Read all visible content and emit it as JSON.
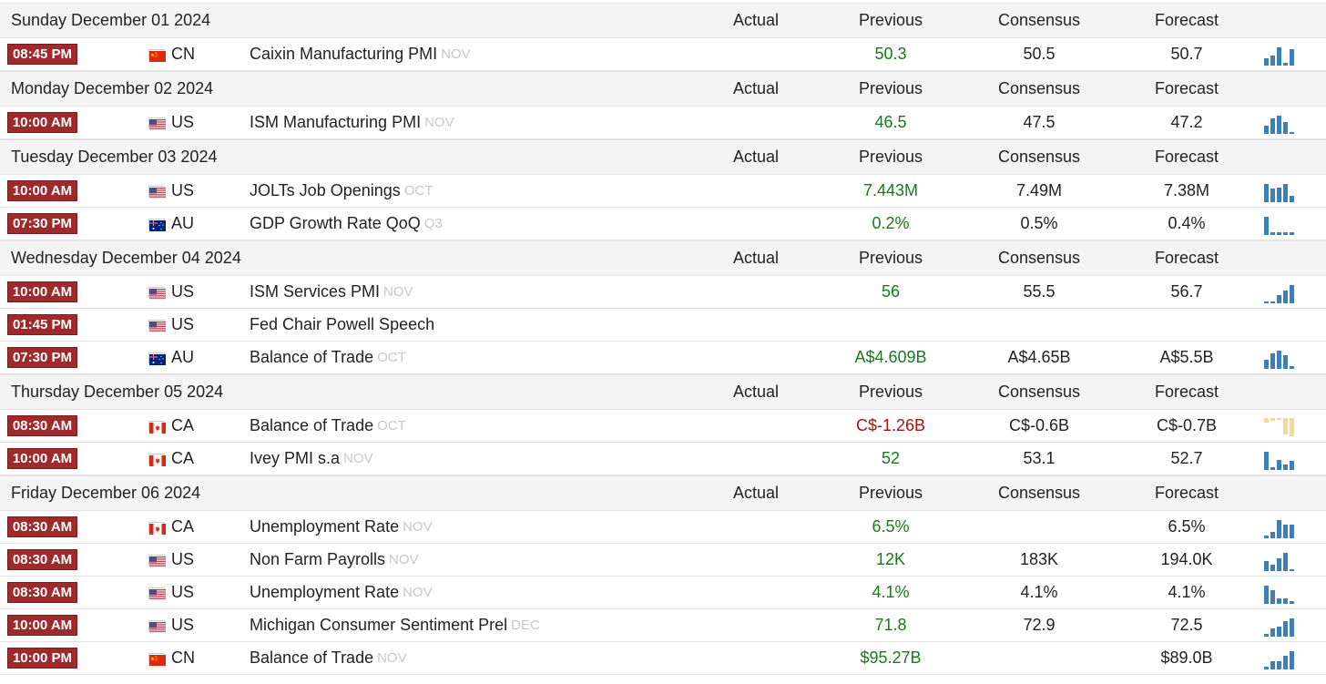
{
  "columns": {
    "actual": "Actual",
    "previous": "Previous",
    "consensus": "Consensus",
    "forecast": "Forecast"
  },
  "days": [
    {
      "date": "Sunday December 01 2024",
      "events": [
        {
          "time": "08:45 PM",
          "flag": "cn",
          "country": "CN",
          "event": "Caixin Manufacturing PMI",
          "ref": "NOV",
          "actual": "",
          "previous": "50.3",
          "previous_trend": "up",
          "consensus": "50.5",
          "forecast": "50.7",
          "spark": [
            0.4,
            0.55,
            1.0,
            0.15,
            0.9
          ],
          "spark_color": "blue"
        }
      ]
    },
    {
      "date": "Monday December 02 2024",
      "events": [
        {
          "time": "10:00 AM",
          "flag": "us",
          "country": "US",
          "event": "ISM Manufacturing PMI",
          "ref": "NOV",
          "actual": "",
          "previous": "46.5",
          "previous_trend": "up",
          "consensus": "47.5",
          "forecast": "47.2",
          "spark": [
            0.45,
            0.85,
            1.0,
            0.65,
            0.1
          ],
          "spark_color": "blue"
        }
      ]
    },
    {
      "date": "Tuesday December 03 2024",
      "events": [
        {
          "time": "10:00 AM",
          "flag": "us",
          "country": "US",
          "event": "JOLTs Job Openings",
          "ref": "OCT",
          "actual": "",
          "previous": "7.443M",
          "previous_trend": "up",
          "consensus": "7.49M",
          "forecast": "7.38M",
          "spark": [
            1.0,
            0.75,
            0.8,
            1.0,
            0.35
          ],
          "spark_color": "blue"
        },
        {
          "time": "07:30 PM",
          "flag": "au",
          "country": "AU",
          "event": "GDP Growth Rate QoQ",
          "ref": "Q3",
          "actual": "",
          "previous": "0.2%",
          "previous_trend": "up",
          "consensus": "0.5%",
          "forecast": "0.4%",
          "spark": [
            1.0,
            0.15,
            0.15,
            0.15,
            0.15
          ],
          "spark_color": "blue"
        }
      ]
    },
    {
      "date": "Wednesday December 04 2024",
      "events": [
        {
          "time": "10:00 AM",
          "flag": "us",
          "country": "US",
          "event": "ISM Services PMI",
          "ref": "NOV",
          "actual": "",
          "previous": "56",
          "previous_trend": "up",
          "consensus": "55.5",
          "forecast": "56.7",
          "spark": [
            0.1,
            0.1,
            0.45,
            0.7,
            1.0
          ],
          "spark_color": "blue"
        },
        {
          "time": "01:45 PM",
          "flag": "us",
          "country": "US",
          "event": "Fed Chair Powell Speech",
          "ref": "",
          "actual": "",
          "previous": "",
          "previous_trend": "",
          "consensus": "",
          "forecast": "",
          "spark": [],
          "spark_color": "blue"
        },
        {
          "time": "07:30 PM",
          "flag": "au",
          "country": "AU",
          "event": "Balance of Trade",
          "ref": "OCT",
          "actual": "",
          "previous": "A$4.609B",
          "previous_trend": "up",
          "consensus": "A$4.65B",
          "forecast": "A$5.5B",
          "spark": [
            0.5,
            0.85,
            1.0,
            0.75,
            0.15
          ],
          "spark_color": "blue"
        }
      ]
    },
    {
      "date": "Thursday December 05 2024",
      "events": [
        {
          "time": "08:30 AM",
          "flag": "ca",
          "country": "CA",
          "event": "Balance of Trade",
          "ref": "OCT",
          "actual": "",
          "previous": "C$-1.26B",
          "previous_trend": "down",
          "consensus": "C$-0.6B",
          "forecast": "C$-0.7B",
          "spark": [
            0.25,
            0.15,
            0.1,
            0.9,
            1.0
          ],
          "spark_color": "tan"
        },
        {
          "time": "10:00 AM",
          "flag": "ca",
          "country": "CA",
          "event": "Ivey PMI s.a",
          "ref": "NOV",
          "actual": "",
          "previous": "52",
          "previous_trend": "up",
          "consensus": "53.1",
          "forecast": "52.7",
          "spark": [
            1.0,
            0.15,
            0.55,
            0.3,
            0.5
          ],
          "spark_color": "blue"
        }
      ]
    },
    {
      "date": "Friday December 06 2024",
      "events": [
        {
          "time": "08:30 AM",
          "flag": "ca",
          "country": "CA",
          "event": "Unemployment Rate",
          "ref": "NOV",
          "actual": "",
          "previous": "6.5%",
          "previous_trend": "up",
          "consensus": "",
          "forecast": "6.5%",
          "spark": [
            0.15,
            0.35,
            1.0,
            0.75,
            0.75
          ],
          "spark_color": "blue"
        },
        {
          "time": "08:30 AM",
          "flag": "us",
          "country": "US",
          "event": "Non Farm Payrolls",
          "ref": "NOV",
          "actual": "",
          "previous": "12K",
          "previous_trend": "up",
          "consensus": "183K",
          "forecast": "194.0K",
          "spark": [
            0.55,
            0.35,
            0.7,
            1.0,
            0.1
          ],
          "spark_color": "blue"
        },
        {
          "time": "08:30 AM",
          "flag": "us",
          "country": "US",
          "event": "Unemployment Rate",
          "ref": "NOV",
          "actual": "",
          "previous": "4.1%",
          "previous_trend": "up",
          "consensus": "4.1%",
          "forecast": "4.1%",
          "spark": [
            1.0,
            0.75,
            0.3,
            0.3,
            0.15
          ],
          "spark_color": "blue"
        },
        {
          "time": "10:00 AM",
          "flag": "us",
          "country": "US",
          "event": "Michigan Consumer Sentiment Prel",
          "ref": "DEC",
          "actual": "",
          "previous": "71.8",
          "previous_trend": "up",
          "consensus": "72.9",
          "forecast": "72.5",
          "spark": [
            0.15,
            0.45,
            0.55,
            0.85,
            1.0
          ],
          "spark_color": "blue"
        },
        {
          "time": "10:00 PM",
          "flag": "cn",
          "country": "CN",
          "event": "Balance of Trade",
          "ref": "NOV",
          "actual": "",
          "previous": "$95.27B",
          "previous_trend": "up",
          "consensus": "",
          "forecast": "$89.0B",
          "spark": [
            0.15,
            0.45,
            0.45,
            0.75,
            1.0
          ],
          "spark_color": "blue"
        }
      ]
    }
  ],
  "colors": {
    "time_badge": "#9e2a2b",
    "header_bg": "#f4f4f4",
    "previous_up": "#1a7a1a",
    "previous_down": "#a11515",
    "spark_blue": "#3d7fb6",
    "spark_tan": "#f0d9a0"
  }
}
